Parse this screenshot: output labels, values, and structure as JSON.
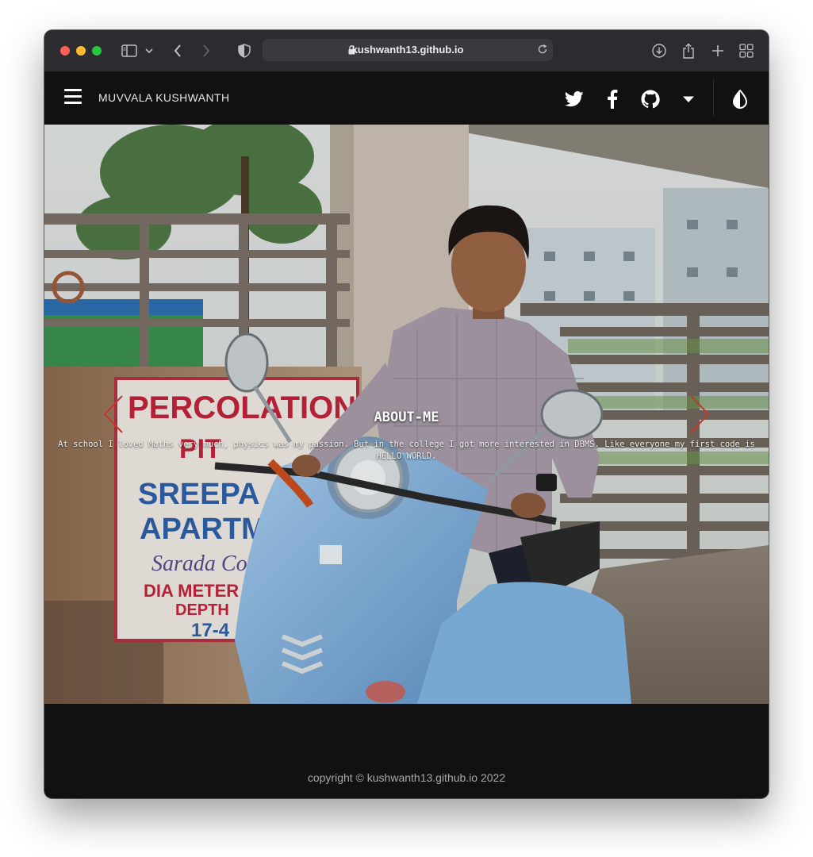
{
  "browser": {
    "url": "kushwanth13.github.io",
    "toolbar_icons": [
      "sidebar-icon",
      "chevron-down-icon",
      "back-icon",
      "forward-icon",
      "shield-icon",
      "lock-icon",
      "reload-icon",
      "download-icon",
      "share-icon",
      "new-tab-icon",
      "tab-overview-icon"
    ]
  },
  "nav": {
    "brand": "MUVVALA KUSHWANTH",
    "icons": [
      "menu-icon",
      "twitter-icon",
      "facebook-icon",
      "github-icon",
      "caret-down-icon",
      "theme-toggle-icon"
    ]
  },
  "hero": {
    "title": "ABOUT-ME",
    "text": "At school I loved Maths very much, physics was my passion. But in the college I got more interested in DBMS. Like everyone my first code is HELLO WORLD.",
    "arrow_color": "#c0392b"
  },
  "footer": {
    "copyright": "copyright © kushwanth13.github.io 2022"
  },
  "colors": {
    "nav_bg": "#111111",
    "toolbar_bg": "#2c2b2f",
    "scooter": "#7fb3e0"
  }
}
